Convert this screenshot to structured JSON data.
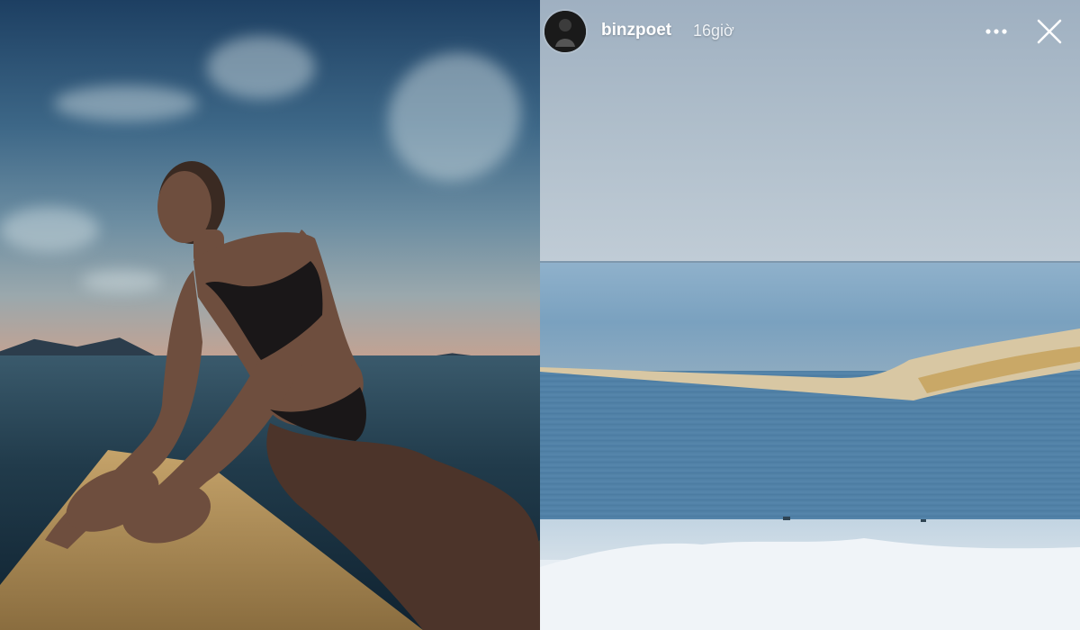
{
  "story": {
    "username": "binzpoet",
    "time_ago": "16giờ",
    "icons": {
      "more": "more-horizontal-icon",
      "close": "close-icon"
    }
  },
  "colors": {
    "header_text": "#ffffff",
    "sea_blue": "#4f7fa4",
    "sky_left": "#3d6787"
  }
}
